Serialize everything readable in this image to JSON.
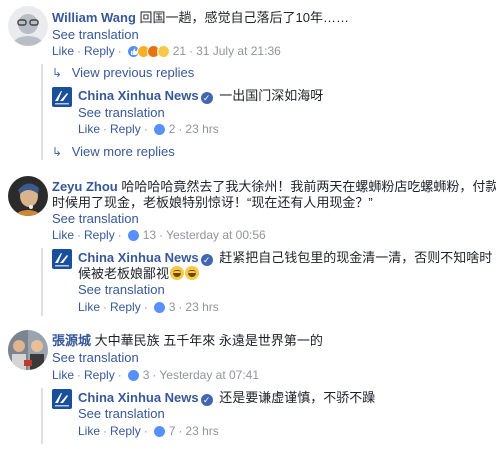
{
  "c1": {
    "author": "William Wang",
    "text": "回国一趟，感觉自己落后了10年……",
    "see_translation": "See translation",
    "like": "Like",
    "reply": "Reply",
    "reactions": "21",
    "time": "31 July at 21:36",
    "reaction_icons": [
      "like-icon",
      "haha-icon",
      "angry-icon",
      "wow-icon"
    ]
  },
  "view_previous": "View previous replies",
  "r1": {
    "author": "China Xinhua News",
    "text": "一出国门深如海呀",
    "see_translation": "See translation",
    "like": "Like",
    "reply": "Reply",
    "reactions": "2",
    "time": "23 hrs"
  },
  "view_more": "View more replies",
  "c2": {
    "author": "Zeyu Zhou",
    "text_line1": "哈哈哈哈竟然去了我大徐州！我前两天在螺蛳粉店吃螺蛳粉，付款的",
    "text_line2": "时候用了现金，老板娘特别惊讶！“现在还有人用现金？”",
    "see_translation": "See translation",
    "like": "Like",
    "reply": "Reply",
    "reactions": "13",
    "time": "Yesterday at 00:56"
  },
  "r2": {
    "author": "China Xinhua News",
    "text_line1": "赶紧把自己钱包里的现金清一清，否则不知啥时",
    "text_line2": "候被老板娘鄙视",
    "see_translation": "See translation",
    "like": "Like",
    "reply": "Reply",
    "reactions": "3",
    "time": "23 hrs"
  },
  "c3": {
    "author": "張源城",
    "text": "大中華民族 五千年來 永遠是世界第一的",
    "see_translation": "See translation",
    "like": "Like",
    "reply": "Reply",
    "reactions": "3",
    "time": "Yesterday at 07:41"
  },
  "r3": {
    "author": "China Xinhua News",
    "text": "还是要谦虚谨慎，不骄不躁",
    "see_translation": "See translation",
    "like": "Like",
    "reply": "Reply",
    "reactions": "7",
    "time": "23 hrs"
  },
  "colors": {
    "link": "#365899",
    "meta": "#90949c",
    "like_blue": "#4267b2",
    "divider": "#dddfe2",
    "xinhua_blue": "#1a4f9c"
  }
}
